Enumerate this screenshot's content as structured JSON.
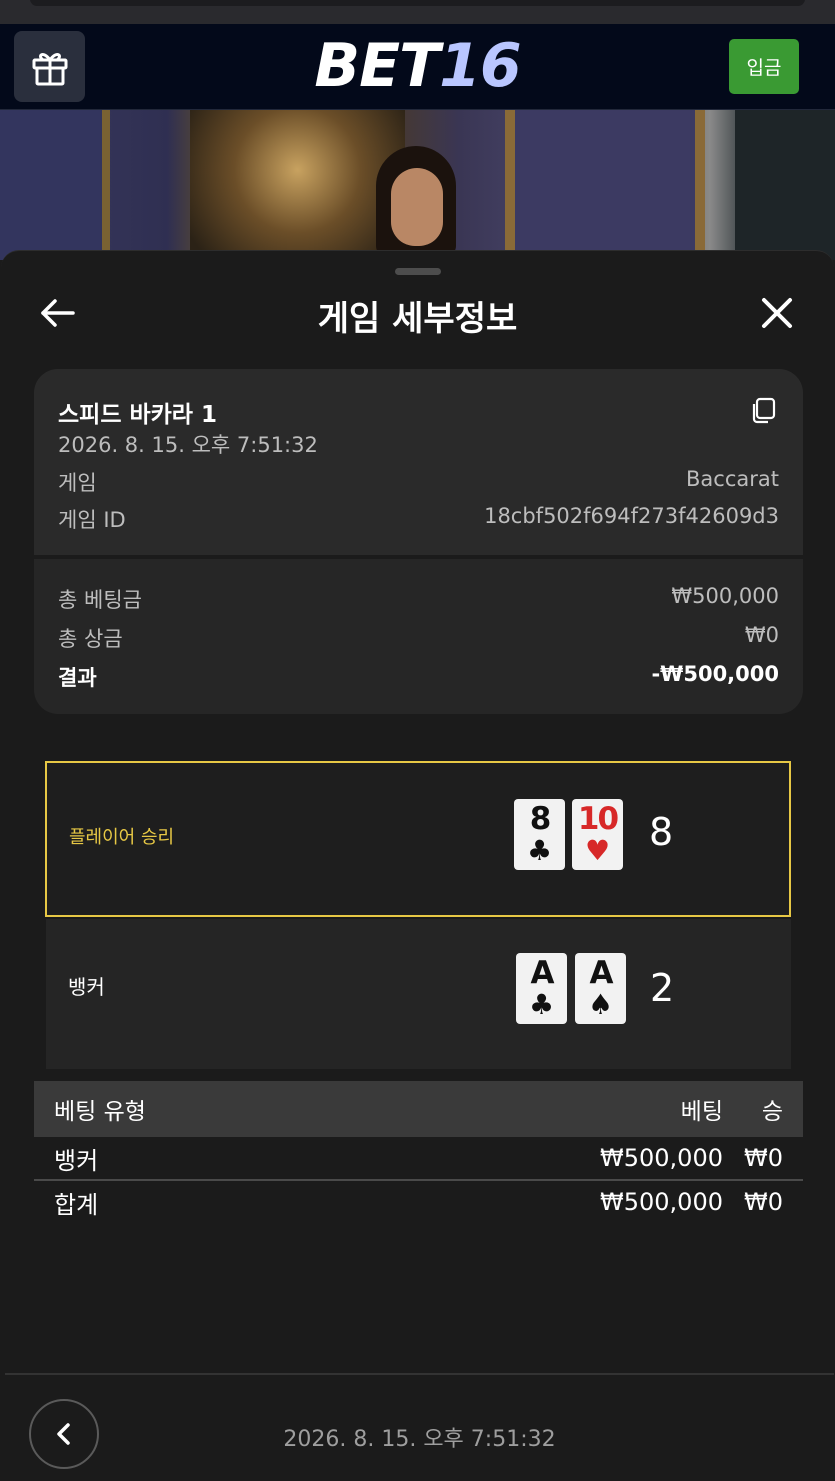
{
  "app": {
    "logo_bet": "BET",
    "logo_num": "16"
  },
  "header": {
    "deposit_label": "입금"
  },
  "sheet": {
    "title": "게임 세부정보"
  },
  "game": {
    "name": "스피드 바카라 1",
    "datetime": "2026. 8. 15. 오후 7:51:32",
    "type_label": "게임",
    "type_value": "Baccarat",
    "id_label": "게임 ID",
    "id_value": "18cbf502f694f273f42609d3"
  },
  "summary": {
    "total_bet_label": "총 베팅금",
    "total_bet_value": "₩500,000",
    "total_win_label": "총 상금",
    "total_win_value": "₩0",
    "result_label": "결과",
    "result_value": "-₩500,000"
  },
  "hands": {
    "player": {
      "label": "플레이어 승리",
      "cards": [
        {
          "rank": "8",
          "suit": "♣",
          "color": "black"
        },
        {
          "rank": "10",
          "suit": "♥",
          "color": "red"
        }
      ],
      "score": "8",
      "highlight_color": "#e7c845"
    },
    "banker": {
      "label": "뱅커",
      "cards": [
        {
          "rank": "A",
          "suit": "♣",
          "color": "black"
        },
        {
          "rank": "A",
          "suit": "♠",
          "color": "black"
        }
      ],
      "score": "2"
    }
  },
  "bets": {
    "headers": {
      "type": "베팅 유형",
      "bet": "베팅",
      "win": "승"
    },
    "rows": [
      {
        "type": "뱅커",
        "bet": "₩500,000",
        "win": "₩0"
      }
    ],
    "total": {
      "type": "합계",
      "bet": "₩500,000",
      "win": "₩0"
    }
  },
  "footer": {
    "datetime": "2026. 8. 15. 오후 7:51:32"
  },
  "icons": {
    "gift": "gift-icon",
    "back": "arrow-left-icon",
    "close": "close-icon",
    "copy": "copy-icon",
    "prev": "chevron-left-icon"
  },
  "colors": {
    "deposit": "#3a9a33",
    "header_bg": "#03091a",
    "accent_yellow": "#e7c845"
  }
}
